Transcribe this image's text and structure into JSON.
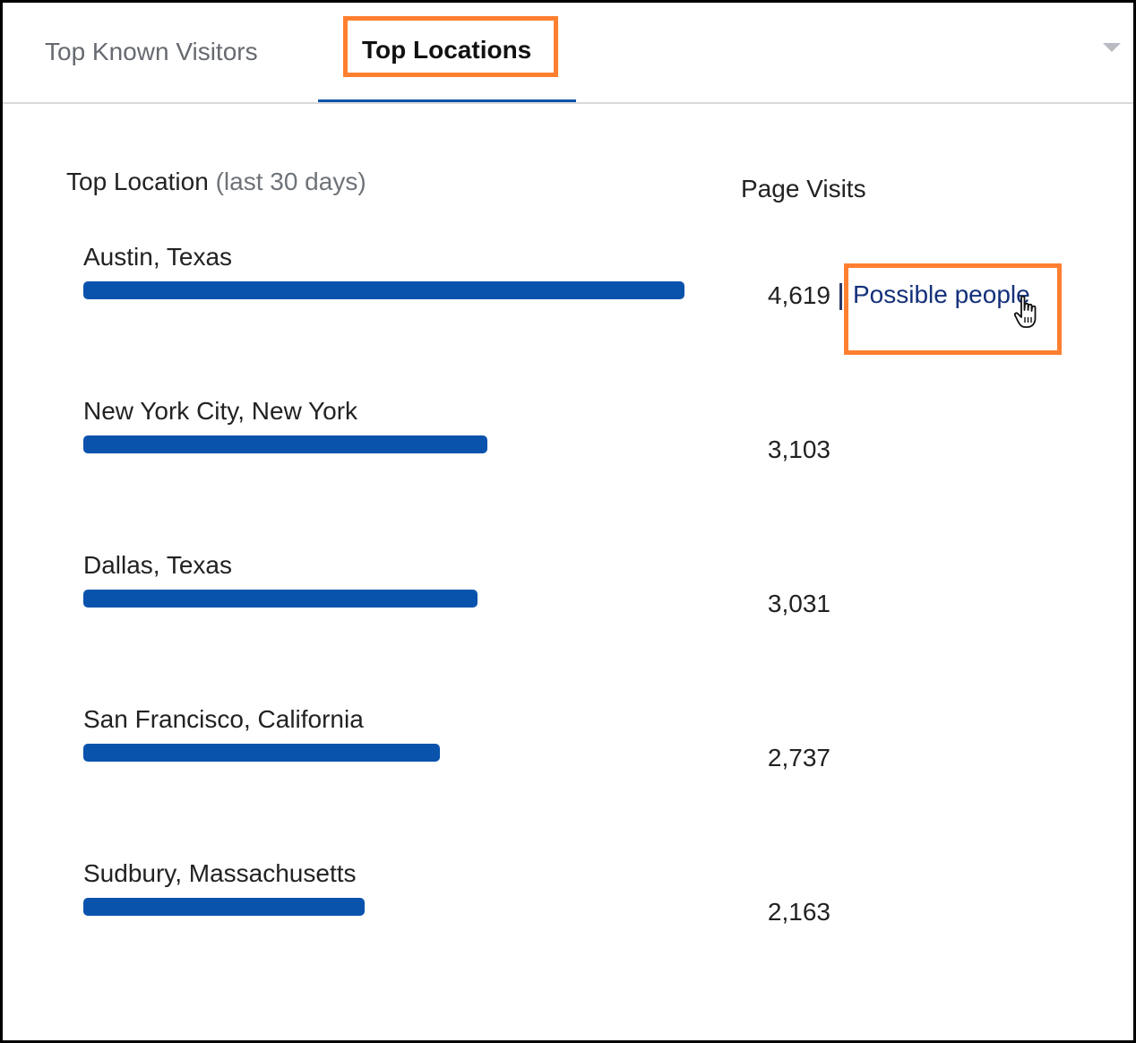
{
  "tabs": {
    "known_visitors": "Top Known Visitors",
    "locations": "Top Locations",
    "active": "locations"
  },
  "header": {
    "title": "Top Location",
    "subtitle": "(last 30 days)",
    "visits_label": "Page Visits"
  },
  "colors": {
    "bar": "#0a53ad",
    "highlight": "#ff7f30",
    "link": "#14307a"
  },
  "rows": [
    {
      "location": "Austin, Texas",
      "visits": "4,619",
      "value": 4619,
      "link": "Possible people"
    },
    {
      "location": "New York City, New York",
      "visits": "3,103",
      "value": 3103
    },
    {
      "location": "Dallas, Texas",
      "visits": "3,031",
      "value": 3031
    },
    {
      "location": "San Francisco, California",
      "visits": "2,737",
      "value": 2737
    },
    {
      "location": "Sudbury, Massachusetts",
      "visits": "2,163",
      "value": 2163
    }
  ],
  "icons": {
    "dropdown": "chevron-down-icon",
    "cursor": "hand-pointer-icon"
  }
}
